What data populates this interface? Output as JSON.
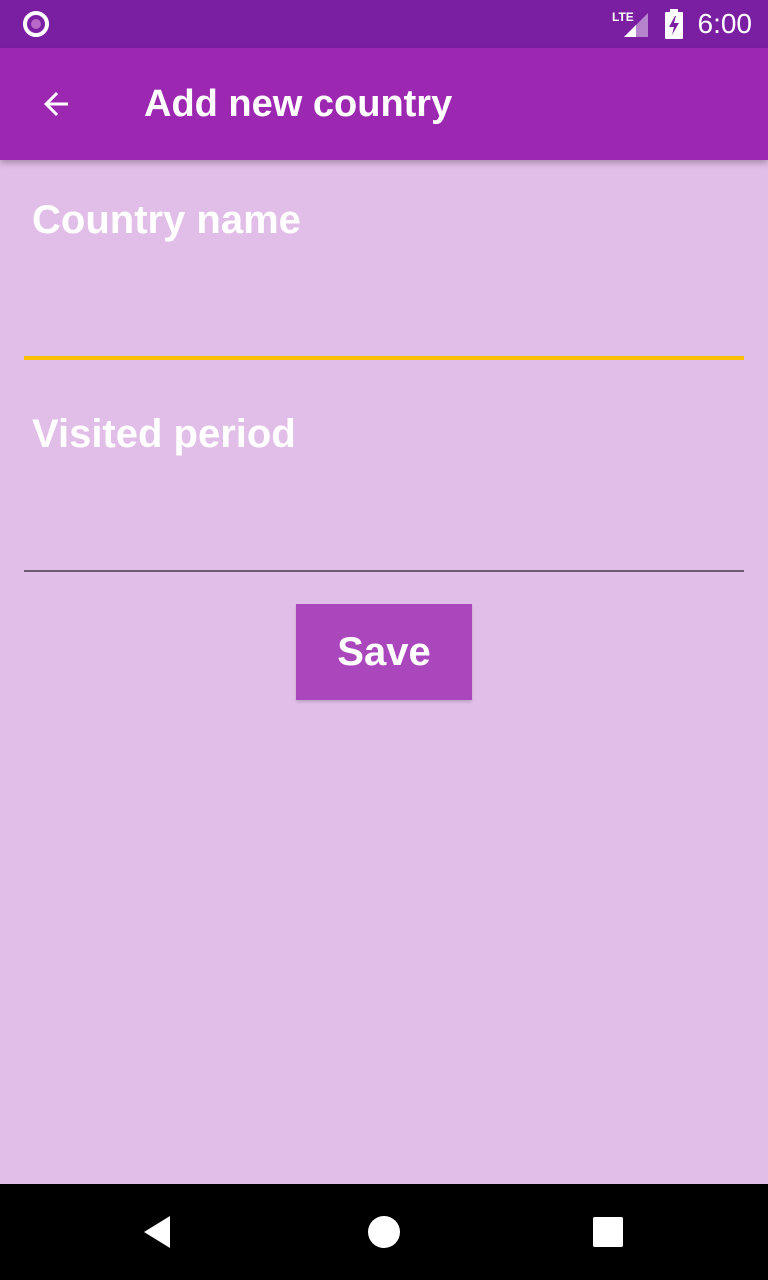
{
  "status_bar": {
    "time": "6:00",
    "network_label": "LTE",
    "icons": [
      "notification-circle-icon",
      "lte-signal-icon",
      "battery-charging-icon"
    ]
  },
  "app_bar": {
    "title": "Add new country",
    "back_icon": "arrow-back-icon"
  },
  "form": {
    "country_name": {
      "label": "Country name",
      "value": ""
    },
    "visited_period": {
      "label": "Visited period",
      "value": ""
    },
    "save_label": "Save"
  },
  "nav_bar": {
    "icons": [
      "back-triangle-icon",
      "home-circle-icon",
      "recents-square-icon"
    ]
  },
  "colors": {
    "status_bar": "#7b1fa2",
    "app_bar": "#9c27b0",
    "background": "#e1bee7",
    "accent": "#ffc107",
    "button": "#ab47bc"
  }
}
